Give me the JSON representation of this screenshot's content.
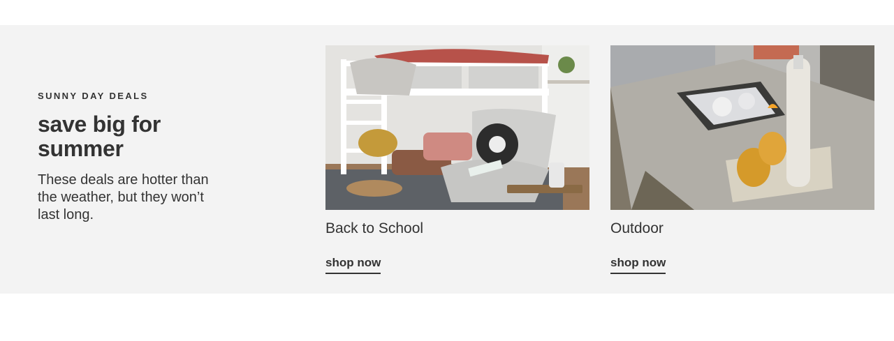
{
  "promo": {
    "eyebrow": "SUNNY DAY DEALS",
    "headline": "save big for summer",
    "description": "These deals are hotter than the weather, but they won’t last long."
  },
  "cards": [
    {
      "title": "Back to School",
      "cta": "shop now",
      "image": "bunk-bed-reading-nook-photo"
    },
    {
      "title": "Outdoor",
      "cta": "shop now",
      "image": "patio-fire-table-photo"
    }
  ],
  "colors": {
    "band": "#f3f3f3",
    "text": "#333333"
  }
}
